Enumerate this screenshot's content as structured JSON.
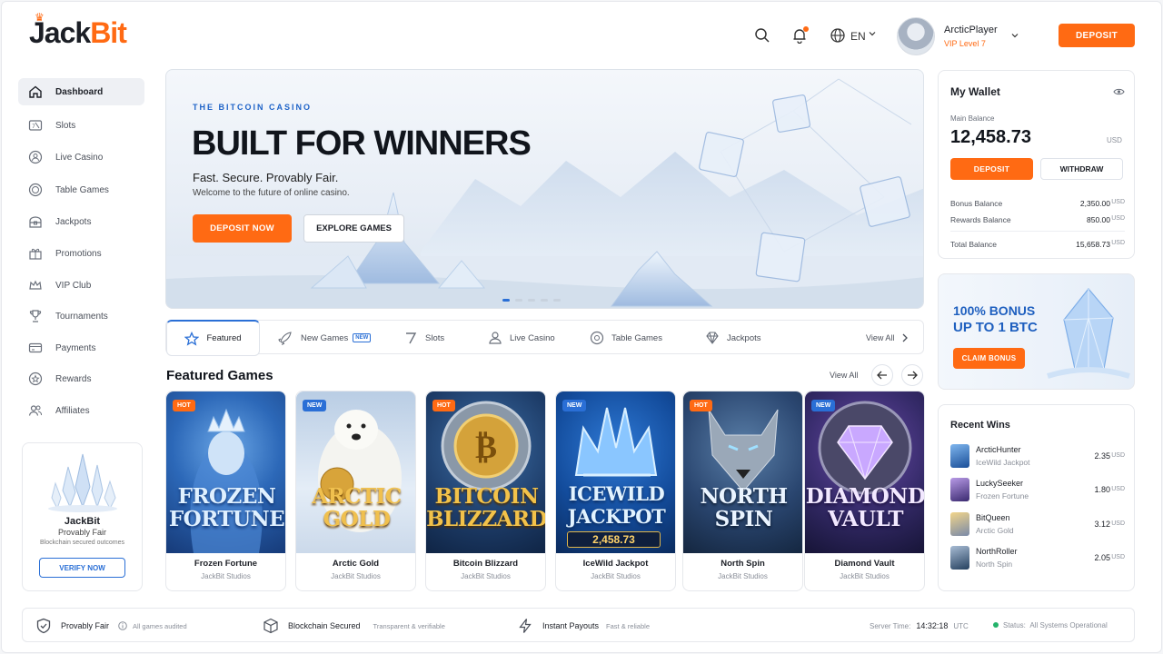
{
  "brand": {
    "logo_left": "Jack",
    "logo_right": "Bit"
  },
  "header": {
    "language": "EN",
    "user_name": "ArcticPlayer",
    "user_level": "VIP Level 7",
    "deposit_label": "DEPOSIT",
    "icons": [
      "search-icon",
      "bell-icon",
      "globe-icon",
      "chevron-down-icon"
    ]
  },
  "sidebar": {
    "items": [
      {
        "label": "Dashboard",
        "icon": "home-icon",
        "active": true
      },
      {
        "label": "Slots",
        "icon": "slot-machine-icon"
      },
      {
        "label": "Live Casino",
        "icon": "live-casino-icon"
      },
      {
        "label": "Table Games",
        "icon": "chip-icon"
      },
      {
        "label": "Jackpots",
        "icon": "treasure-icon"
      },
      {
        "label": "Promotions",
        "icon": "gift-icon"
      },
      {
        "label": "VIP Club",
        "icon": "crown-icon"
      },
      {
        "label": "Tournaments",
        "icon": "trophy-icon"
      },
      {
        "label": "Payments",
        "icon": "card-icon"
      },
      {
        "label": "Rewards",
        "icon": "star-icon"
      },
      {
        "label": "Affiliates",
        "icon": "users-icon"
      }
    ],
    "card": {
      "title": "JackBit",
      "subtitle": "Provably Fair",
      "caption": "Blockchain secured outcomes",
      "button": "VERIFY NOW"
    }
  },
  "hero": {
    "kicker": "THE BITCOIN CASINO",
    "title": "BUILT FOR WINNERS",
    "subtitle": "Fast. Secure. Provably Fair.",
    "tagline": "Welcome to the future of online casino.",
    "primary_button": "DEPOSIT NOW",
    "secondary_button": "EXPLORE GAMES",
    "slides": 5,
    "active_slide": 1
  },
  "tabs": {
    "items": [
      {
        "label": "Featured",
        "icon": "star-icon",
        "active": true
      },
      {
        "label": "New Games",
        "icon": "rocket-icon",
        "tag": "NEW"
      },
      {
        "label": "Slots",
        "icon": "seven-icon"
      },
      {
        "label": "Live Casino",
        "icon": "dealer-icon"
      },
      {
        "label": "Table Games",
        "icon": "chip-icon"
      },
      {
        "label": "Jackpots",
        "icon": "diamond-icon"
      }
    ],
    "view_all": "View All"
  },
  "featured": {
    "title": "Featured Games",
    "view_all": "View All",
    "games": [
      {
        "art_title_1": "FROZEN",
        "art_title_2": "FORTUNE",
        "name": "Frozen Fortune",
        "studio": "JackBit Studios",
        "badge": "HOT"
      },
      {
        "art_title_1": "ARCTIC",
        "art_title_2": "GOLD",
        "name": "Arctic Gold",
        "studio": "JackBit Studios",
        "badge": "NEW"
      },
      {
        "art_title_1": "BITCOIN",
        "art_title_2": "BLIZZARD",
        "name": "Bitcoin Blizzard",
        "studio": "JackBit Studios",
        "badge": "HOT"
      },
      {
        "art_title_1": "ICEWILD",
        "art_title_2": "JACKPOT",
        "name": "IceWild Jackpot",
        "studio": "JackBit Studios",
        "badge": "NEW",
        "jackpot": "2,458.73"
      },
      {
        "art_title_1": "NORTH",
        "art_title_2": "SPIN",
        "name": "North Spin",
        "studio": "JackBit Studios",
        "badge": "HOT"
      },
      {
        "art_title_1": "DIAMOND",
        "art_title_2": "VAULT",
        "name": "Diamond Vault",
        "studio": "JackBit Studios",
        "badge": "NEW"
      }
    ]
  },
  "wallet": {
    "title": "My Wallet",
    "main_label": "Main Balance",
    "main_amount": "12,458.73",
    "currency": "USD",
    "deposit": "DEPOSIT",
    "withdraw": "WITHDRAW",
    "rows": [
      {
        "label": "Bonus Balance",
        "value": "2,350.00",
        "unit": "USD"
      },
      {
        "label": "Rewards Balance",
        "value": "850.00",
        "unit": "USD"
      },
      {
        "label": "Total Balance",
        "value": "15,658.73",
        "unit": "USD"
      }
    ]
  },
  "bonus": {
    "line1": "100% BONUS",
    "line2": "UP TO 1 BTC",
    "button": "CLAIM BONUS"
  },
  "recent_wins": {
    "title": "Recent Wins",
    "items": [
      {
        "player": "ArcticHunter",
        "game": "IceWild Jackpot",
        "amount": "2.35",
        "unit": "USD"
      },
      {
        "player": "LuckySeeker",
        "game": "Frozen Fortune",
        "amount": "1.80",
        "unit": "USD"
      },
      {
        "player": "BitQueen",
        "game": "Arctic Gold",
        "amount": "3.12",
        "unit": "USD"
      },
      {
        "player": "NorthRoller",
        "game": "North Spin",
        "amount": "2.05",
        "unit": "USD"
      }
    ]
  },
  "footer": {
    "items": [
      {
        "label": "Provably Fair",
        "sub": "All games audited",
        "icon": "shield-check-icon"
      },
      {
        "label": "Blockchain Secured",
        "sub": "Transparent & verifiable",
        "icon": "cube-icon"
      },
      {
        "label": "Instant Payouts",
        "sub": "Fast & reliable",
        "icon": "lightning-icon"
      }
    ],
    "server_time_label": "Server Time:",
    "server_time": "14:32:18",
    "timezone": "UTC",
    "status_label": "Status:",
    "status": "All Systems Operational"
  },
  "colors": {
    "accent": "#ff6a13",
    "primary_blue": "#2a6fd6",
    "status_green": "#24b36b"
  }
}
